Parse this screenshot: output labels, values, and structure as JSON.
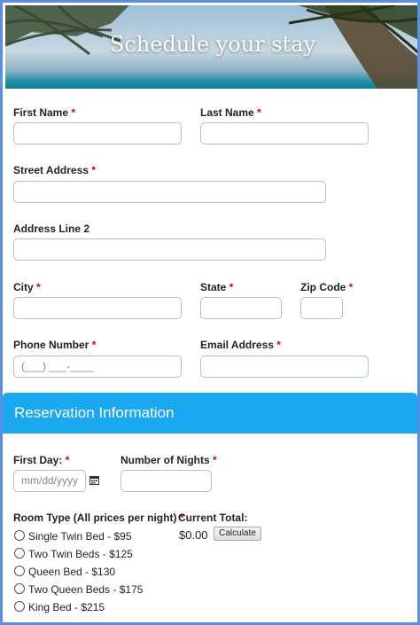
{
  "header": {
    "title": "Schedule your stay"
  },
  "form": {
    "first_name": {
      "label": "First Name",
      "required": "*",
      "value": ""
    },
    "last_name": {
      "label": "Last Name",
      "required": "*",
      "value": ""
    },
    "street": {
      "label": "Street Address",
      "required": "*",
      "value": ""
    },
    "address2": {
      "label": "Address Line 2",
      "value": ""
    },
    "city": {
      "label": "City",
      "required": "*",
      "value": ""
    },
    "state": {
      "label": "State",
      "required": "*",
      "value": ""
    },
    "zip": {
      "label": "Zip Code",
      "required": "*",
      "value": ""
    },
    "phone": {
      "label": "Phone Number",
      "required": "*",
      "placeholder": "(___) ___-____"
    },
    "email": {
      "label": "Email Address",
      "required": "*",
      "value": ""
    }
  },
  "reservation": {
    "title": "Reservation Information",
    "first_day": {
      "label": "First Day:",
      "required": "*",
      "placeholder": "mm/dd/yyyy"
    },
    "nights": {
      "label": "Number of Nights",
      "required": "*",
      "value": ""
    },
    "room_type": {
      "label": "Room Type (All prices per night)",
      "required": "*",
      "options": [
        "Single Twin Bed - $95",
        "Two Twin Beds - $125",
        "Queen Bed - $130",
        "Two Queen Beds - $175",
        "King Bed - $215"
      ]
    },
    "current_total": {
      "label": "Current Total:",
      "value": "$0.00",
      "button": "Calculate"
    }
  },
  "colors": {
    "accent": "#1aa8f0",
    "required": "#d0021b",
    "frame": "#5b8fe6"
  },
  "icons": {
    "date_picker": "calendar-icon"
  }
}
